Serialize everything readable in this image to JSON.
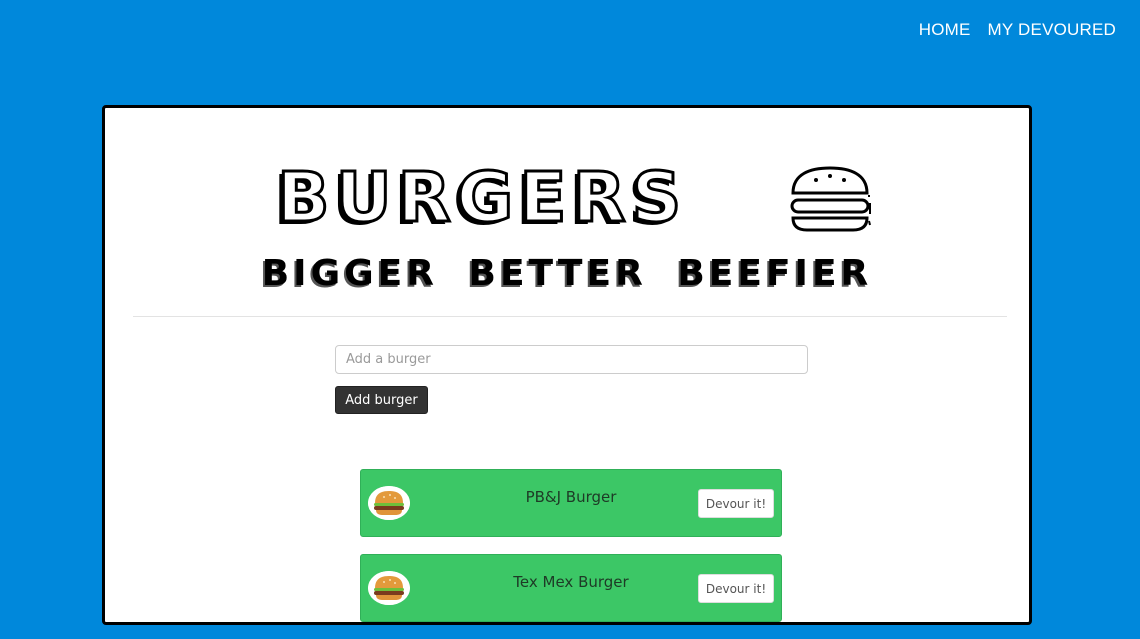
{
  "nav": {
    "home_label": "HOME",
    "devoured_label": "MY DEVOURED"
  },
  "header": {
    "title": "BURGERS",
    "subtitle": "BIGGER BETTER BEEFIER",
    "icon": "burger-icon"
  },
  "form": {
    "input_placeholder": "Add a burger",
    "input_value": "",
    "add_button_label": "Add burger"
  },
  "burgers": [
    {
      "name": "PB&J Burger",
      "button_label": "Devour it!",
      "icon": "burger-avatar-icon"
    },
    {
      "name": "Tex Mex Burger",
      "button_label": "Devour it!",
      "icon": "burger-avatar-icon"
    }
  ],
  "colors": {
    "background": "#0088db",
    "card": "#ffffff",
    "item": "#3cc766",
    "add_button": "#333333"
  }
}
